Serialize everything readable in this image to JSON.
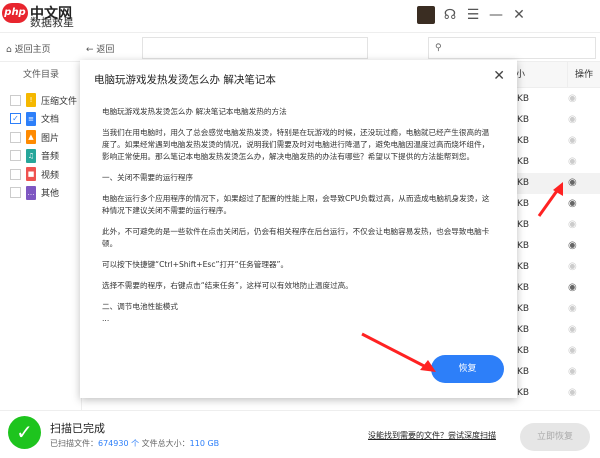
{
  "app": {
    "logo": "php",
    "brand_overlay": "中文网",
    "title": "数据救星"
  },
  "window_controls": [
    "avatar",
    "headset-icon",
    "menu-icon",
    "minimize-icon",
    "close-icon"
  ],
  "toolbar": {
    "home": "返回主页",
    "back": "返回"
  },
  "sidebar": {
    "header": "文件目录",
    "items": [
      {
        "label": "压缩文件",
        "checked": false,
        "color": "#f5b800",
        "glyph": "!"
      },
      {
        "label": "文档",
        "checked": true,
        "color": "#2d7ff9",
        "glyph": "≡"
      },
      {
        "label": "图片",
        "checked": false,
        "color": "#ff8a00",
        "glyph": "▲"
      },
      {
        "label": "音频",
        "checked": false,
        "color": "#26a69a",
        "glyph": "♫"
      },
      {
        "label": "视频",
        "checked": false,
        "color": "#ef5350",
        "glyph": "■"
      },
      {
        "label": "其他",
        "checked": false,
        "color": "#7e57c2",
        "glyph": "…"
      }
    ]
  },
  "table": {
    "size_header_partial": "小",
    "op_header": "操作",
    "size_unit": "KB",
    "eye_dark_rows": [
      4,
      5,
      7,
      9
    ],
    "highlight_row": 4,
    "row_count": 15
  },
  "modal": {
    "title": "电脑玩游戏发热发烫怎么办 解决笔记本",
    "paragraphs": [
      "电脑玩游戏发热发烫怎么办 解决笔记本电脑发热的方法",
      "当我们在用电脑时，用久了总会感觉电脑发热发烫，特别是在玩游戏的时候，还没玩过瘾，电脑就已经产生很高的温度了。如果经常遇到电脑发热发烫的情况，说明我们需要及时对电脑进行降温了，避免电脑因温度过高而烧坏组件，影响正常使用。那么笔记本电脑发热发烫怎么办，解决电脑发热的办法有哪些？希望以下提供的方法能帮到您。",
      "一、关闭不需要的运行程序",
      "电脑在运行多个应用程序的情况下，如果超过了配置的性能上限，会导致CPU负载过高，从而造成电脑机身发烫，这种情况下建议关闭不需要的运行程序。",
      "此外，不可避免的是一些软件在点击关闭后，仍会有相关程序在后台运行，不仅会让电脑容易发热，也会导致电脑卡顿。",
      "可以按下快捷键“Ctrl+Shift+Esc”打开“任务管理器”。",
      "选择不需要的程序，右键点击“结束任务”，这样可以有效地防止温度过高。",
      "二、调节电池性能模式\n..."
    ],
    "restore": "恢复"
  },
  "bottom": {
    "status": "扫描已完成",
    "scanned_label": "已扫描文件：",
    "scanned_count": "674930 个",
    "size_label": "文件总大小：",
    "size_value": "110 GB",
    "deep_scan": "没能找到需要的文件？尝试深度扫描",
    "recover_now": "立即恢复"
  }
}
